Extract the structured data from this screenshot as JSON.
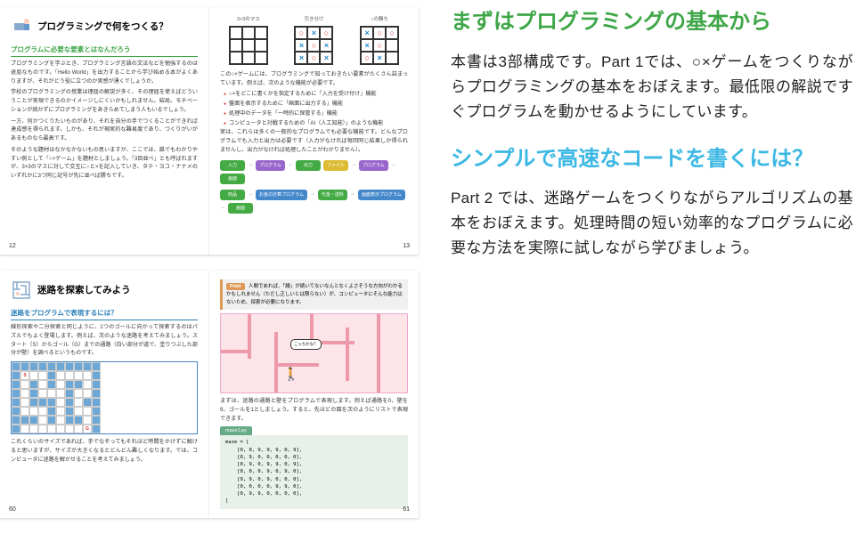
{
  "spread1": {
    "title": "プログラミングで何をつくる？",
    "green_heading": "プログラムに必要な要素とはなんだろう",
    "para1": "プログラミングを学ぶとき、プログラミング言語の文法などを勉強するのは退屈なものです。「Hello World」を出力することから学び始める本がよくありますが、それがどう役に立つのか実感が湧くでしょうか。",
    "para2": "学校のプログラミングの授業は理屈の解説が多く、その理屈を使えばどういうことが実現できるのかイメージしにくいかもしれません。結局、モチベーションが続かずにプログラミングをあきらめてしまう人もいるでしょう。",
    "para3": "一方、何かつくりたいものがあり、それを自分の手でつくることができれば達成感を得られます。しかも、それが現実的な難易度であり、つくりがいがあるものなら最高です。",
    "para4": "そのような題材はなかなかないもの思いますが、ここでは、誰でもわかりやすい例として「○×ゲーム」を題材としましょう。「3目並べ」とも呼ばれますが、3×3のマスに対して交互に○と×を記入していき、タテ・ヨコ・ナナメのいずれかに3つ同じ記号が先に並べば勝ちです。",
    "r_para1": "この○×ゲームには、プログラミングで知っておきたい要素がたくさん詰まっています。例えば、次のような機能が必要です。",
    "bullets": [
      "○×をどこに書くかを指定するために「入力を受け付け」機能",
      "盤面を表示するために「画面に出力する」機能",
      "処理中のデータを「一時的に保管する」機能",
      "コンピュータと対戦するための「AI（人工知能）」のような機能"
    ],
    "r_para2": "実は、これらは多くの一般的なプログラムでも必要な機能です。どんなプログラムでも入力と出力は必要です（入力がなければ毎回同じ結果しか得られませんし、出力がなければ処理したことがわかりません）。",
    "ttt_labels": [
      "3×3のマス",
      "引き分け",
      "○の勝ち"
    ],
    "flow": [
      "入力",
      "プログラム",
      "出力",
      "ファイル",
      "プログラム",
      "画面"
    ],
    "flow2": [
      "商品",
      "お金の計算プログラム",
      "代金・送料",
      "画面表示プログラム",
      "画面"
    ],
    "page_left": "12",
    "page_right": "13"
  },
  "spread2": {
    "title": "迷路を探索してみよう",
    "blue_heading": "迷路をプログラムで表現するには？",
    "para1": "線形探索や二分探索と同じように、1つのゴールに向かって探索するのはパズルでもよく登場します。例えば、次のような迷路を考えてみましょう。スタート（S）からゴール（G）までの通路（白い部分が道で、塗りつぶした部分が壁）を調べるというものです。",
    "para2": "これくらいのサイズであれば、手でなぞってもそれほど時間をかけずに解けると思いますが、サイズが大きくなるとどんどん難しくなります。では、コンピュータに迷路を解かせることを考えてみましょう。",
    "point_label": "Point",
    "point_text": "人間であれば、「線」が続いてないなんとなくよさそうな方向がわかるかもしれません（ただし正しいとは限らない）が、コンピュータにそんな能力はないため、探索が必要になります。",
    "speech": "こっちかな？",
    "r_para1": "まずは、迷路の通路と壁をプログラムで表現します。例えば通路を0、壁を9、ゴールを1としましょう。すると、先ほどの図を次のようにリストで表現できます。",
    "code_label": "maze1.py",
    "code": "maze = [\n    [0, 0, 9, 9, 9, 0, 9],\n    [0, 9, 0, 0, 0, 0, 0],\n    [0, 9, 0, 9, 9, 0, 9],\n    [0, 0, 0, 9, 0, 9, 0],\n    [9, 9, 0, 9, 0, 0, 0],\n    [0, 0, 0, 0, 9, 9, 0],\n    [0, 9, 9, 0, 0, 0, 0],\n]",
    "page_left": "60",
    "page_right": "61"
  },
  "right": {
    "title1": "まずはプログラミングの基本から",
    "body1": "本書は3部構成です。Part 1では、○×ゲームをつくりながらプログラミングの基本をおぼえます。最低限の解説ですぐプログラムを動かせるようにしています。",
    "title2": "シンプルで高速なコードを書くには？",
    "body2": "Part 2 では、迷路ゲームをつくりながらアルゴリズムの基本をおぼえます。処理時間の短い効率的なプログラムに必要な方法を実際に試しながら学びましょう。"
  }
}
